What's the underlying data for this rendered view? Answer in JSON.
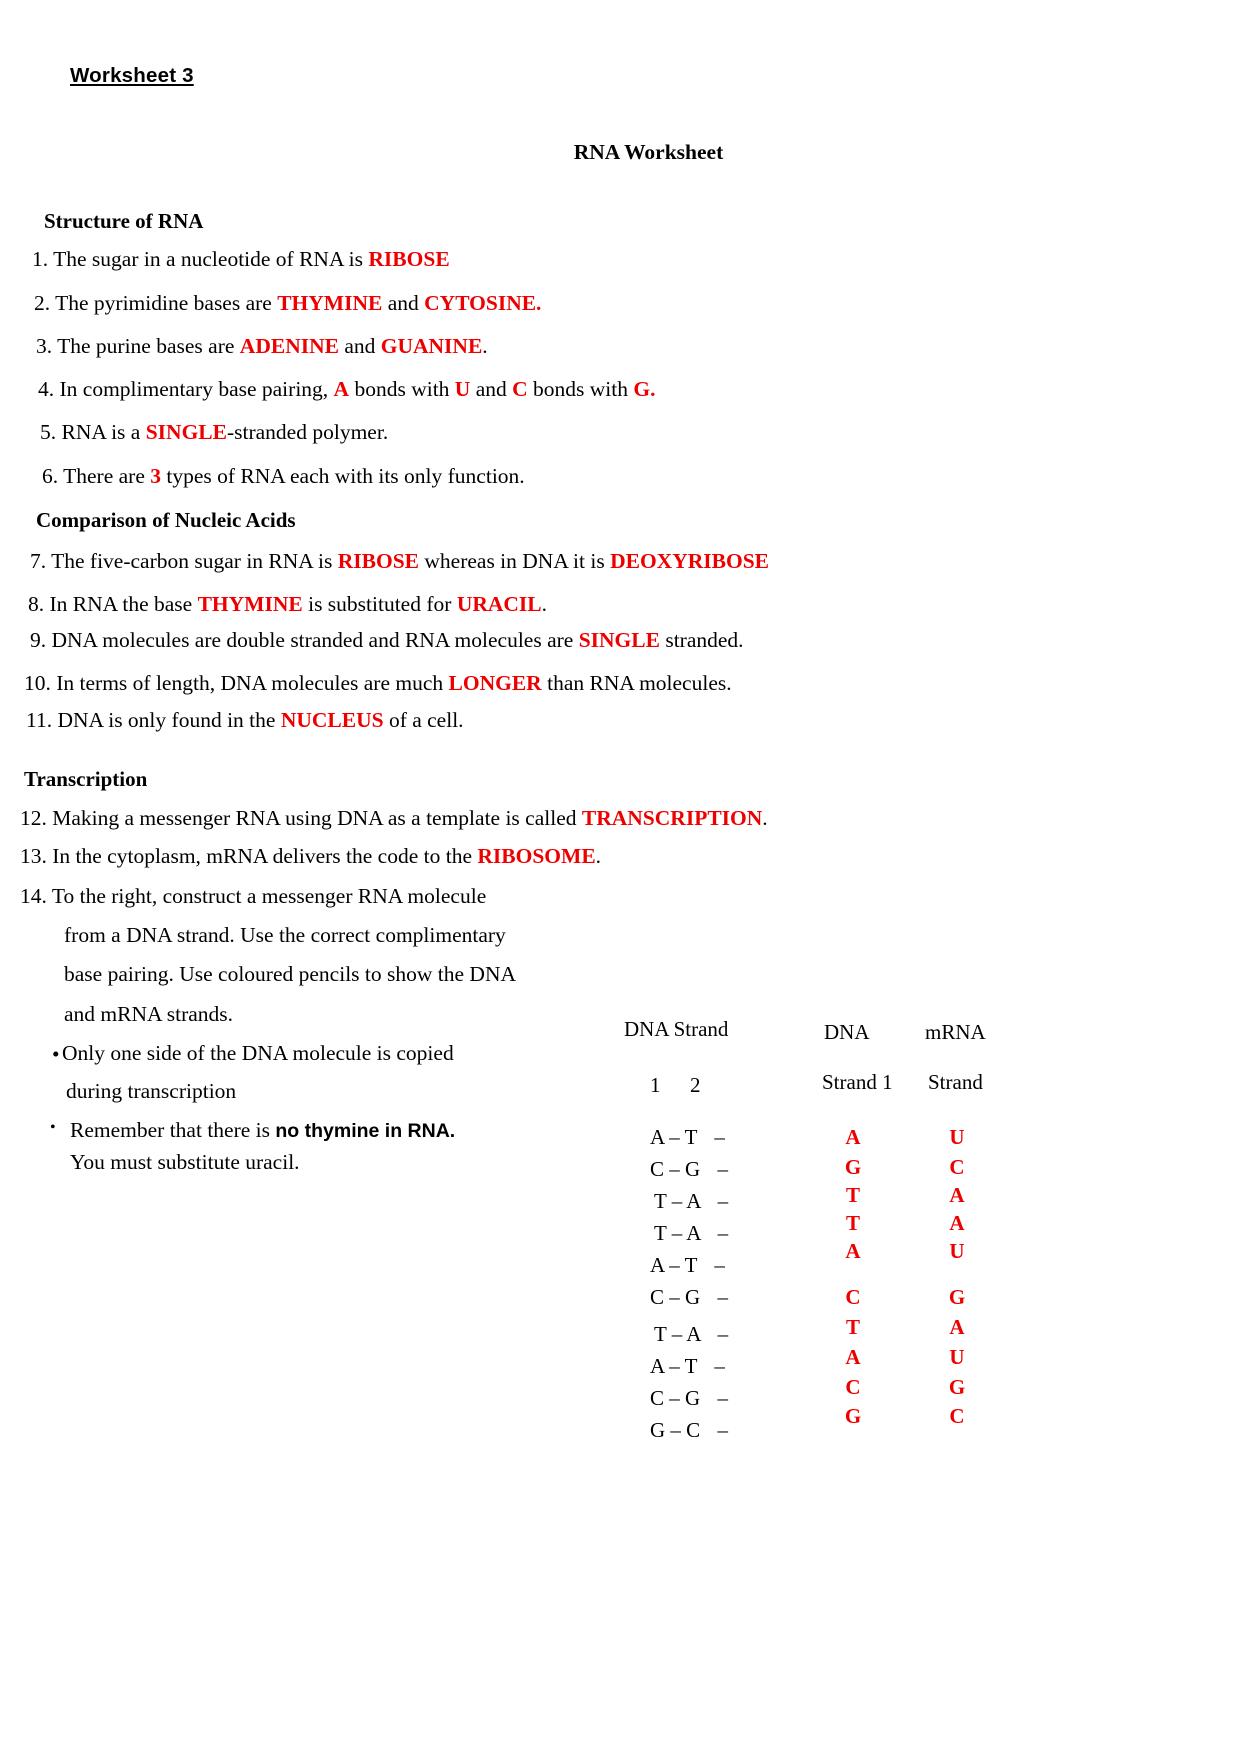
{
  "header": {
    "worksheet_label": "Worksheet 3",
    "document_title": "RNA Worksheet"
  },
  "sections": {
    "structure": {
      "heading": "Structure of RNA",
      "items": [
        {
          "num": "1.",
          "pre": "The sugar in a nucleotide of RNA is ",
          "ans": "RIBOSE",
          "post": ""
        },
        {
          "num": "2.",
          "pre": "The pyrimidine bases are ",
          "ans": "THYMINE",
          "mid": " and ",
          "ans2": "CYTOSINE.",
          "post": ""
        },
        {
          "num": "3.",
          "pre": "The purine bases are ",
          "ans": "ADENINE",
          "mid": "  and ",
          "ans2": "GUANINE",
          "post": "."
        },
        {
          "num": "4.",
          "pre": "In complimentary base pairing, ",
          "ans": "A",
          "mid": " bonds with ",
          "ans2": "U",
          "mid2": " and ",
          "ans3": "C",
          "mid3": " bonds with ",
          "ans4": "G.",
          "post": ""
        },
        {
          "num": "5.",
          "pre": "RNA is a ",
          "ans": "SINGLE",
          "post": "-stranded polymer."
        },
        {
          "num": "6.",
          "pre": "There are ",
          "ans": "3",
          "post": " types of RNA each with its only function."
        }
      ]
    },
    "comparison": {
      "heading": "Comparison of Nucleic Acids",
      "items": [
        {
          "num": "7.",
          "pre": "The five-carbon sugar in RNA is ",
          "ans": "RIBOSE",
          "mid": " whereas in DNA it is ",
          "ans2": "DEOXYRIBOSE",
          "post": ""
        },
        {
          "num": "8.",
          "pre": "In RNA the base ",
          "ans": "THYMINE",
          "mid": "  is substituted for ",
          "ans2": "URACIL",
          "post": "."
        },
        {
          "num": "9.",
          "pre": "DNA molecules are double stranded and RNA molecules are ",
          "ans": "SINGLE",
          "post": " stranded."
        },
        {
          "num": "10.",
          "pre": "In terms of length, DNA molecules are much ",
          "ans": "LONGER",
          "post": " than RNA molecules."
        },
        {
          "num": "11.",
          "pre": "DNA is only found in the ",
          "ans": "NUCLEUS",
          "post": " of a cell."
        }
      ]
    },
    "transcription": {
      "heading": "Transcription",
      "items": [
        {
          "num": "12.",
          "pre": "Making a messenger RNA using DNA as a template  is called ",
          "ans": "TRANSCRIPTION",
          "post": "."
        },
        {
          "num": "13.",
          "pre": "In the cytoplasm, mRNA delivers the code to  the ",
          "ans": "RIBOSOME",
          "post": "."
        }
      ],
      "item14": {
        "num": "14.",
        "line1": "To the right, construct a messenger RNA molecule",
        "line2": "from a DNA strand. Use the correct complimentary",
        "line3": "base pairing.  Use coloured pencils to show the DNA",
        "line4": "and mRNA strands."
      },
      "bullets": [
        {
          "marker": "•",
          "line1": "Only one side of the DNA molecule is copied",
          "line2": "during transcription"
        },
        {
          "marker": "•",
          "line1_pre": "Remember that there is ",
          "line1_bold": "no thymine in RNA.",
          "line2": "You must substitute uracil."
        }
      ]
    }
  },
  "strand_table": {
    "dna_strand_header": "DNA Strand",
    "col_num_1": "1",
    "col_num_2": "2",
    "dna_header_line1": "DNA",
    "dna_header_line2": "Strand 1",
    "mrna_header_line1": "mRNA",
    "mrna_header_line2": "Strand",
    "dash": "–",
    "trailing_dash": "–",
    "pairs": [
      {
        "left": "A",
        "right": "T"
      },
      {
        "left": "C",
        "right": "G"
      },
      {
        "left": "T",
        "right": "A"
      },
      {
        "left": "T",
        "right": "A"
      },
      {
        "left": "A",
        "right": "T"
      },
      {
        "left": "C",
        "right": "G"
      },
      {
        "left": "T",
        "right": "A"
      },
      {
        "left": "A",
        "right": "T"
      },
      {
        "left": "C",
        "right": "G"
      },
      {
        "left": "G",
        "right": "C"
      }
    ],
    "dna_strand1": [
      "A",
      "G",
      "T",
      "T",
      "A",
      "C",
      "T",
      "A",
      "C",
      "G"
    ],
    "mrna_strand": [
      "U",
      "C",
      "A",
      "A",
      "U",
      "G",
      "A",
      "U",
      "G",
      "C"
    ]
  },
  "colors": {
    "answer_red": "#ee0000",
    "text_black": "#000000",
    "page_background": "#ffffff"
  }
}
